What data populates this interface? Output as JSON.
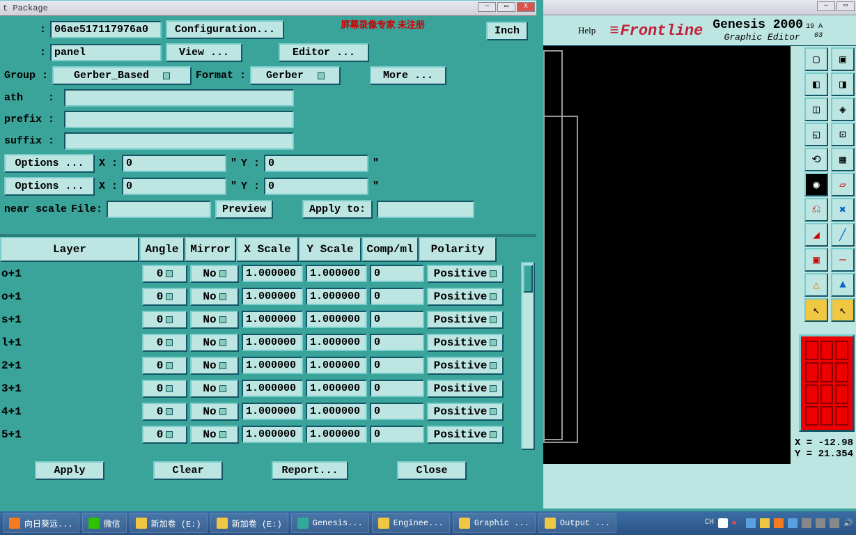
{
  "dialog": {
    "title": "t Package",
    "watermark": "屏幕录像专家 未注册",
    "unit": "Inch",
    "row1": {
      "lbl": ":",
      "job": "06ae517117976a0",
      "config": "Configuration..."
    },
    "row2": {
      "lbl": ":",
      "step": "panel",
      "view": "View ...",
      "editor": "Editor ..."
    },
    "row3": {
      "group_lbl": "Group :",
      "group": "Gerber_Based",
      "format_lbl": "Format :",
      "format": "Gerber",
      "more": "More ..."
    },
    "path_lbl": "ath    :",
    "prefix_lbl": "prefix :",
    "suffix_lbl": "suffix :",
    "opt": "Options ...",
    "x_lbl": "X :",
    "y_lbl": "Y :",
    "x1": "0",
    "y1": "0",
    "x2": "0",
    "y2": "0",
    "q": "\"",
    "near_lbl": "near scale",
    "file_lbl": "File:",
    "preview": "Preview",
    "applyto": "Apply to:",
    "headers": {
      "layer": "Layer",
      "angle": "Angle",
      "mirror": "Mirror",
      "xscale": "X Scale",
      "yscale": "Y Scale",
      "comp": "Comp/ml",
      "polarity": "Polarity"
    },
    "rows": [
      {
        "layer": "o+1",
        "angle": "0",
        "mirror": "No",
        "xs": "1.000000",
        "ys": "1.000000",
        "comp": "0",
        "pol": "Positive"
      },
      {
        "layer": "o+1",
        "angle": "0",
        "mirror": "No",
        "xs": "1.000000",
        "ys": "1.000000",
        "comp": "0",
        "pol": "Positive"
      },
      {
        "layer": "s+1",
        "angle": "0",
        "mirror": "No",
        "xs": "1.000000",
        "ys": "1.000000",
        "comp": "0",
        "pol": "Positive"
      },
      {
        "layer": "l+1",
        "angle": "0",
        "mirror": "No",
        "xs": "1.000000",
        "ys": "1.000000",
        "comp": "0",
        "pol": "Positive"
      },
      {
        "layer": "2+1",
        "angle": "0",
        "mirror": "No",
        "xs": "1.000000",
        "ys": "1.000000",
        "comp": "0",
        "pol": "Positive"
      },
      {
        "layer": "3+1",
        "angle": "0",
        "mirror": "No",
        "xs": "1.000000",
        "ys": "1.000000",
        "comp": "0",
        "pol": "Positive"
      },
      {
        "layer": "4+1",
        "angle": "0",
        "mirror": "No",
        "xs": "1.000000",
        "ys": "1.000000",
        "comp": "0",
        "pol": "Positive"
      },
      {
        "layer": "5+1",
        "angle": "0",
        "mirror": "No",
        "xs": "1.000000",
        "ys": "1.000000",
        "comp": "0",
        "pol": "Positive"
      }
    ],
    "btns": {
      "apply": "Apply",
      "clear": "Clear",
      "report": "Report...",
      "close": "Close"
    }
  },
  "right": {
    "help": "Help",
    "brand": "Frontline",
    "app": "Genesis 2000",
    "sub": "Graphic Editor",
    "date1": "19 A",
    "date2": "03",
    "coord_x": "X = -12.98",
    "coord_y": "Y =  21.354"
  },
  "taskbar": {
    "items": [
      {
        "label": "向日葵远...",
        "color": "#f47b20"
      },
      {
        "label": "微信",
        "color": "#2dc100"
      },
      {
        "label": "新加卷 (E:)",
        "color": "#f0c742"
      },
      {
        "label": "新加卷 (E:)",
        "color": "#f0c742"
      },
      {
        "label": "Genesis...",
        "color": "#3a9"
      },
      {
        "label": "Enginee...",
        "color": "#f0c742"
      },
      {
        "label": "Graphic ...",
        "color": "#f0c742"
      },
      {
        "label": "Output ...",
        "color": "#f0c742"
      }
    ],
    "lang": "CH"
  }
}
